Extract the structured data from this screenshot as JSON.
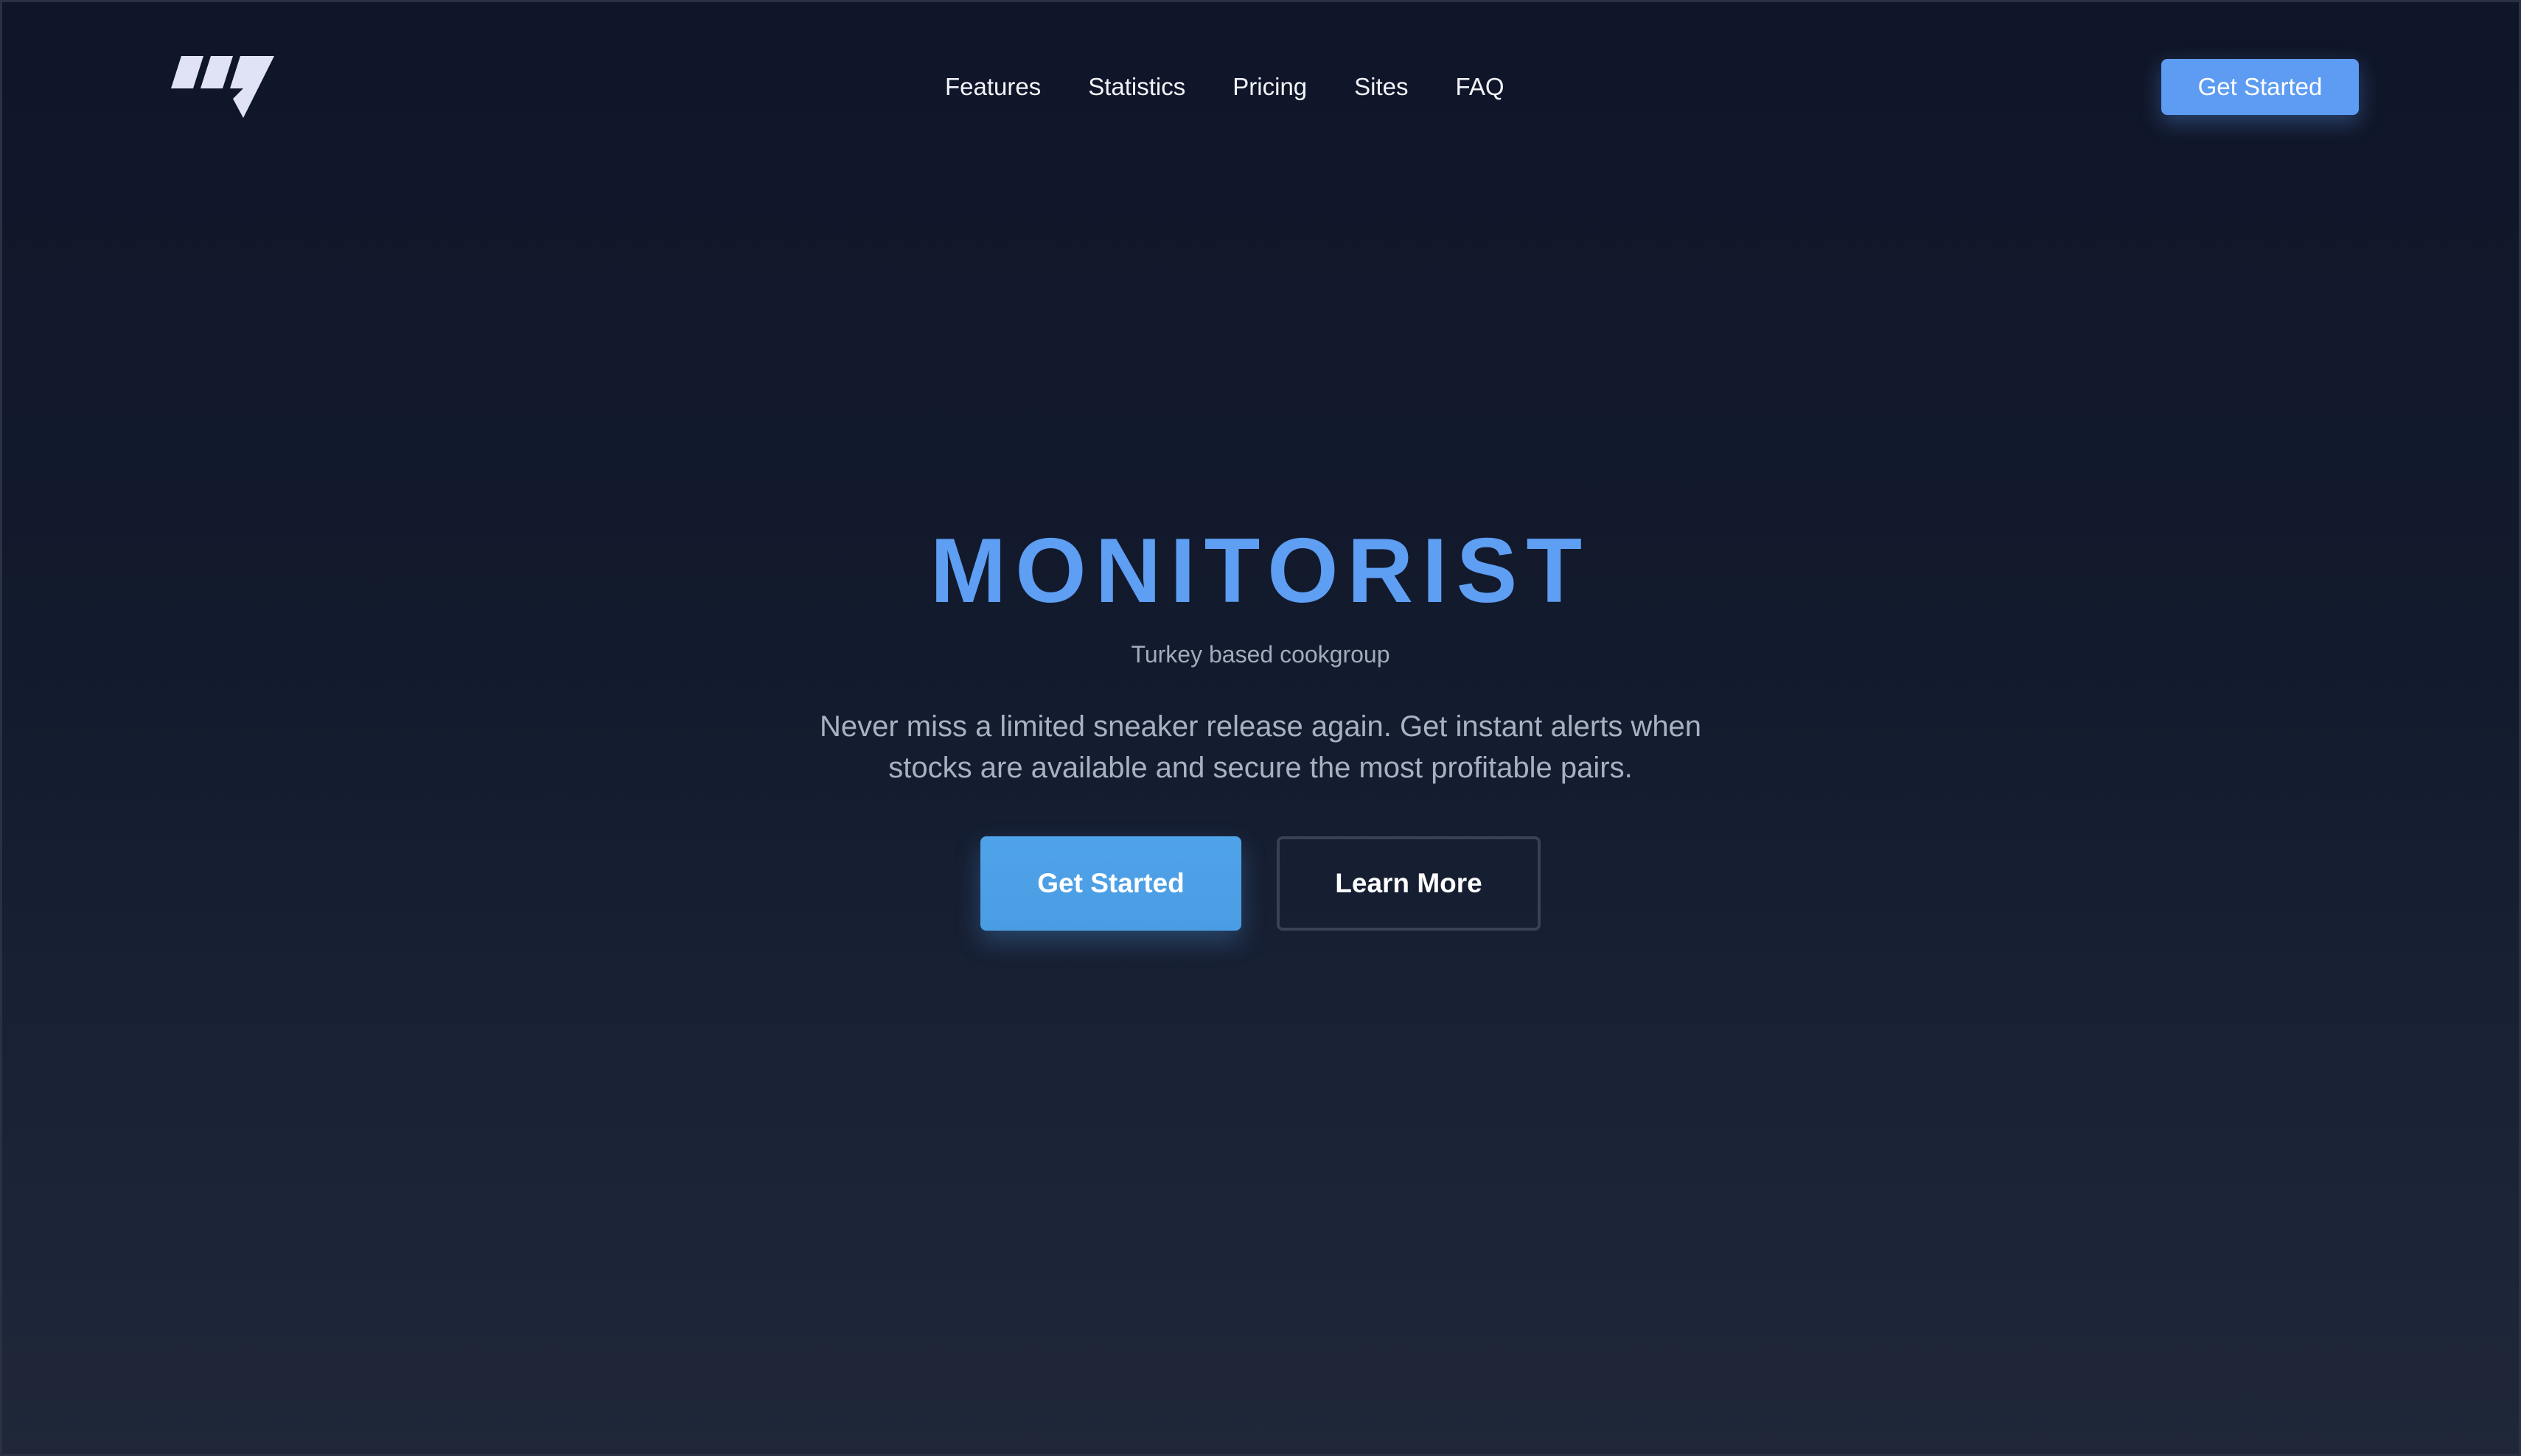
{
  "navbar": {
    "logo_icon": "monitorist-logo-icon",
    "links": [
      {
        "label": "Features"
      },
      {
        "label": "Statistics"
      },
      {
        "label": "Pricing"
      },
      {
        "label": "Sites"
      },
      {
        "label": "FAQ"
      }
    ],
    "cta_label": "Get Started"
  },
  "hero": {
    "title": "MONITORIST",
    "subtitle": "Turkey based cookgroup",
    "description": "Never miss a limited sneaker release again. Get instant alerts when stocks are available and secure the most profitable pairs.",
    "primary_button_label": "Get Started",
    "secondary_button_label": "Learn More"
  },
  "colors": {
    "accent": "#5e9ef3",
    "primary_button": "#4fa3e8",
    "background_top": "#101629",
    "background_bottom": "#1f2739",
    "muted_text": "#a3acbc"
  }
}
